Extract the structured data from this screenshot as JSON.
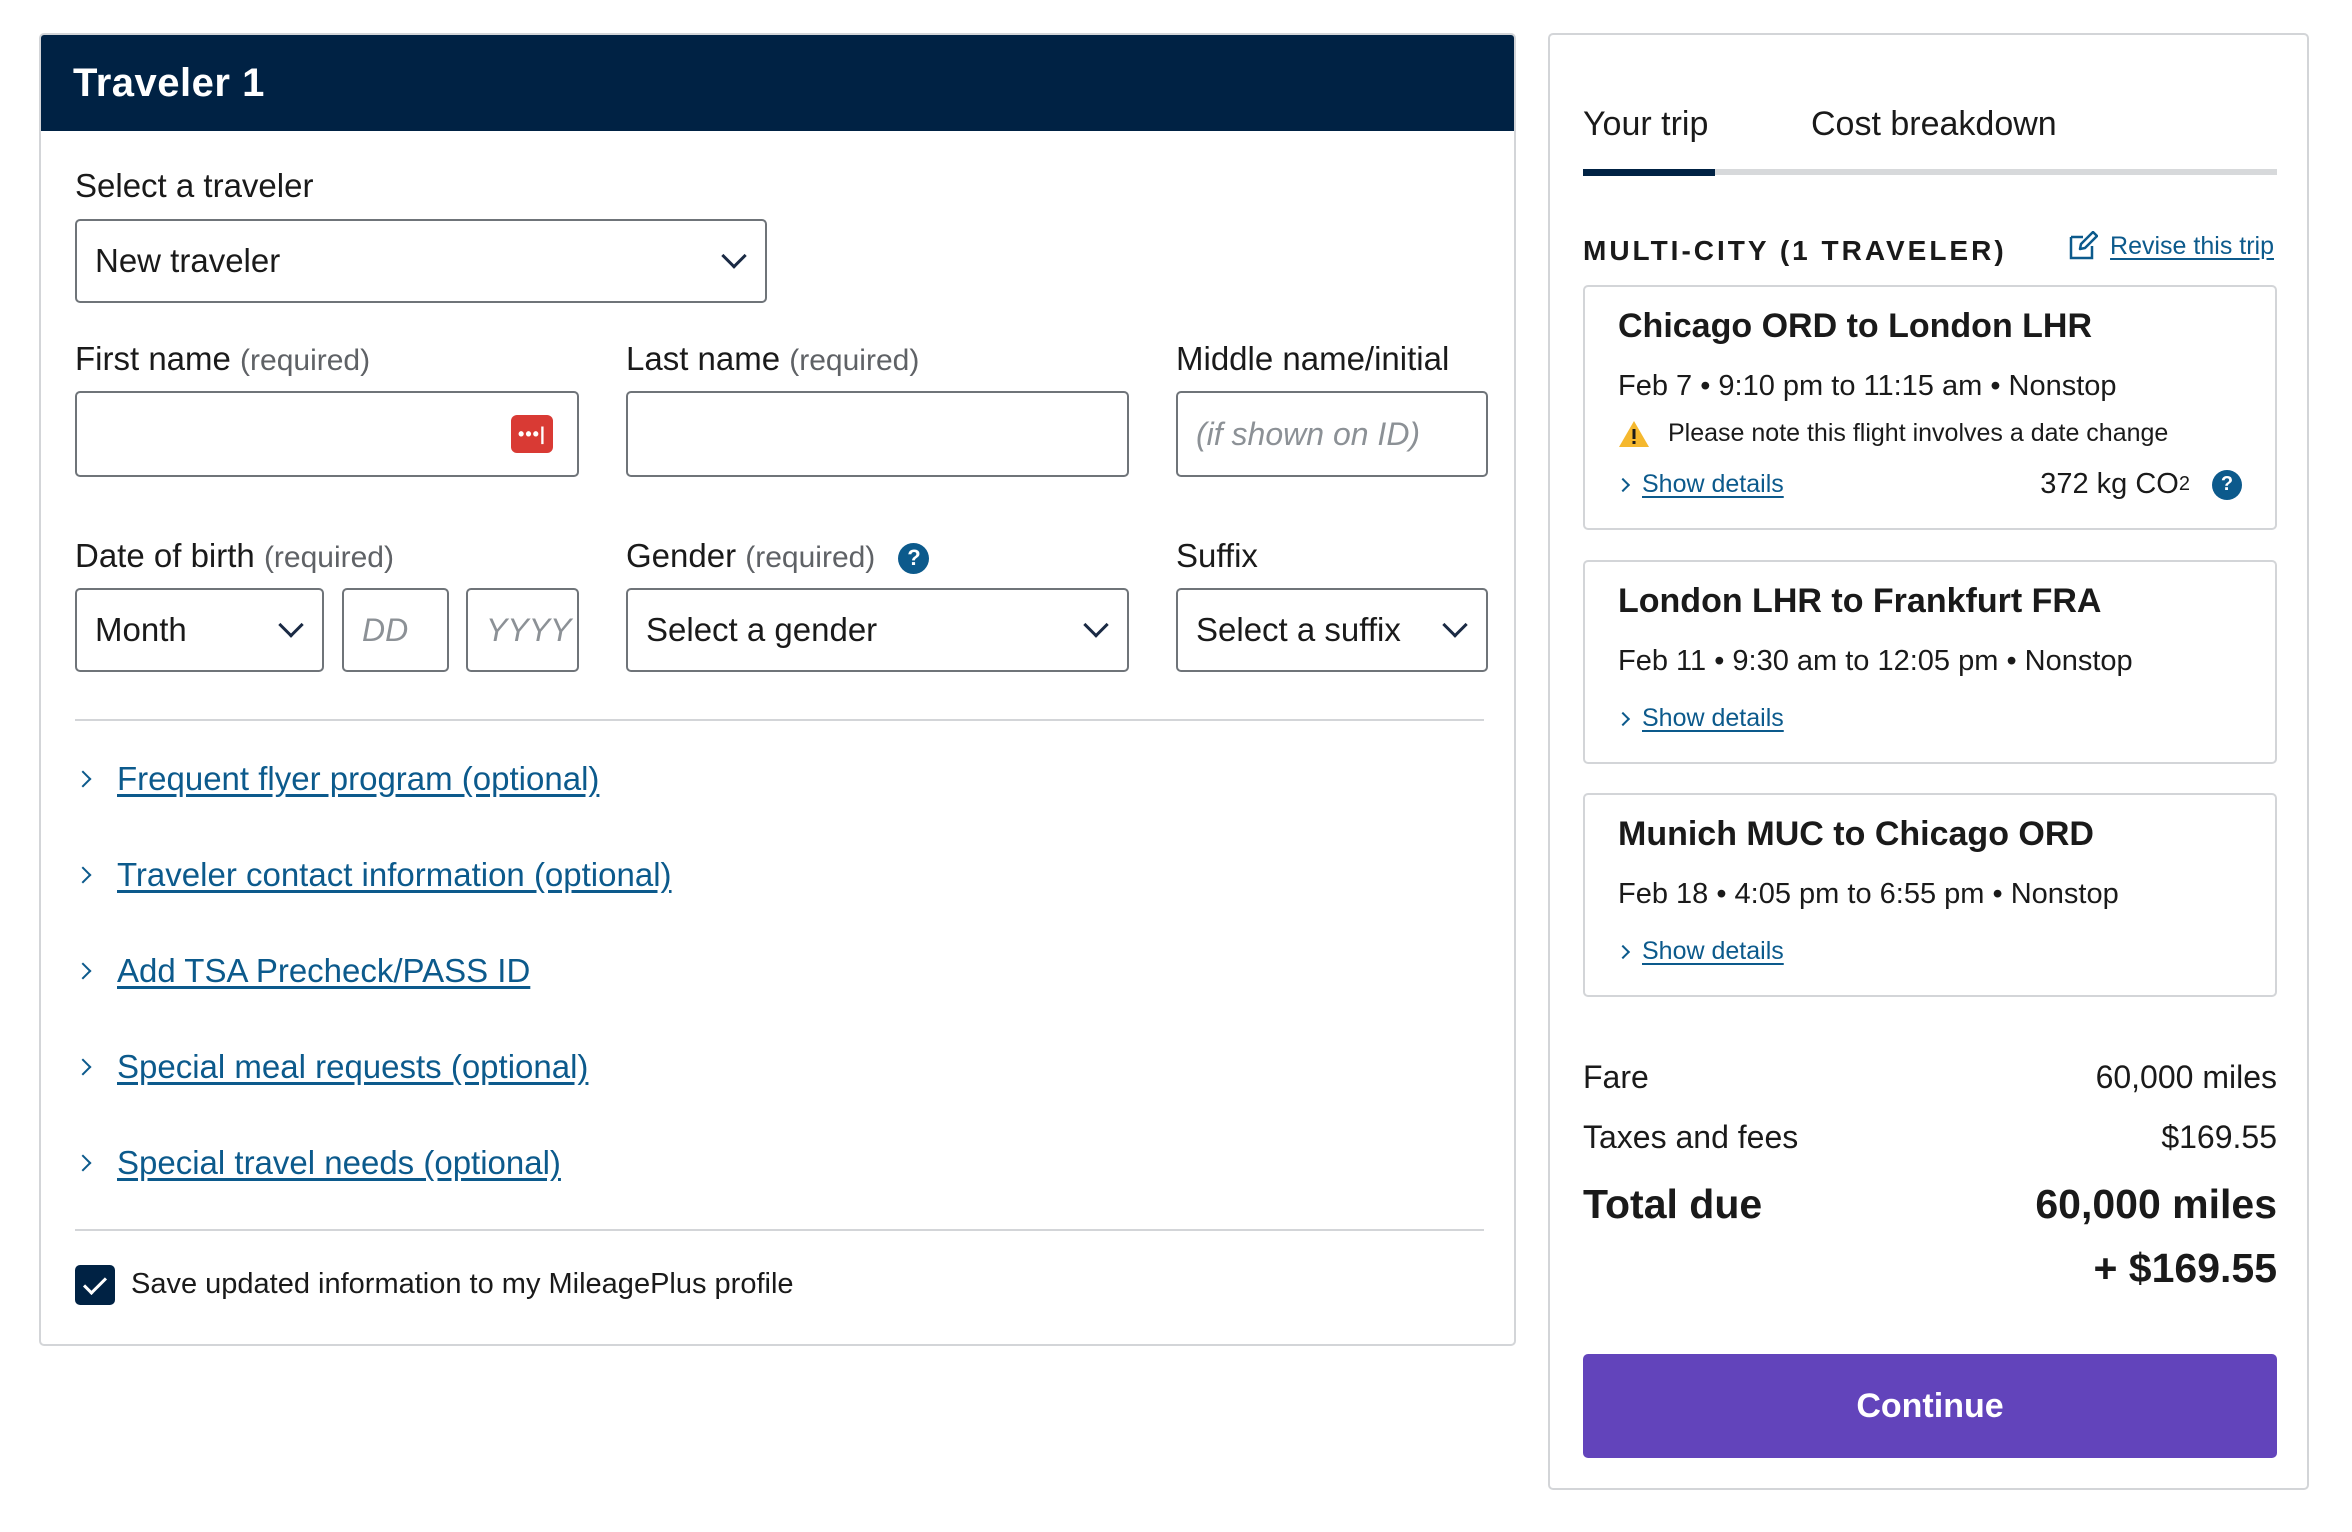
{
  "traveler_form": {
    "header_title": "Traveler 1",
    "select_traveler": {
      "label": "Select a traveler",
      "value": "New traveler"
    },
    "first_name": {
      "label": "First name",
      "required_note": "(required)",
      "value": ""
    },
    "last_name": {
      "label": "Last name",
      "required_note": "(required)",
      "value": ""
    },
    "middle_name": {
      "label": "Middle name/initial",
      "placeholder": "(if shown on ID)"
    },
    "date_of_birth": {
      "label": "Date of birth",
      "required_note": "(required)",
      "month_value": "Month",
      "day_placeholder": "DD",
      "year_placeholder": "YYYY"
    },
    "gender": {
      "label": "Gender",
      "required_note": "(required)",
      "value": "Select a gender"
    },
    "suffix": {
      "label": "Suffix",
      "value": "Select a suffix"
    },
    "expanders": [
      "Frequent flyer program (optional)",
      "Traveler contact information (optional)",
      "Add TSA Precheck/PASS ID",
      "Special meal requests (optional)",
      "Special travel needs (optional)"
    ],
    "save_profile": {
      "label": "Save updated information to my MileagePlus profile",
      "checked": true
    }
  },
  "summary": {
    "tabs": [
      {
        "label": "Your trip",
        "active": true
      },
      {
        "label": "Cost breakdown",
        "active": false
      }
    ],
    "trip_type": "MULTI-CITY (1 TRAVELER)",
    "revise_label": "Revise this trip",
    "segments": [
      {
        "route": "Chicago ORD to London LHR",
        "schedule": "Feb 7 • 9:10 pm to 11:15 am • Nonstop",
        "warning": "Please note this flight involves a date change",
        "details_label": "Show details",
        "co2_value": "372 kg CO",
        "co2_sub": "2"
      },
      {
        "route": "London LHR to Frankfurt FRA",
        "schedule": "Feb 11 • 9:30 am to 12:05 pm • Nonstop",
        "details_label": "Show details"
      },
      {
        "route": "Munich MUC to Chicago ORD",
        "schedule": "Feb 18 • 4:05 pm to 6:55 pm • Nonstop",
        "details_label": "Show details"
      }
    ],
    "fare": {
      "label": "Fare",
      "value": "60,000 miles"
    },
    "taxes": {
      "label": "Taxes and fees",
      "value": "$169.55"
    },
    "total": {
      "label": "Total due",
      "miles": "60,000 miles",
      "cash": "+ $169.55"
    },
    "continue_label": "Continue"
  },
  "colors": {
    "header_navy": "#002244",
    "link_blue": "#0c5a8c",
    "continue_purple": "#6244bb",
    "warning_yellow": "#f5b82e",
    "password_icon_red": "#d93a34"
  }
}
